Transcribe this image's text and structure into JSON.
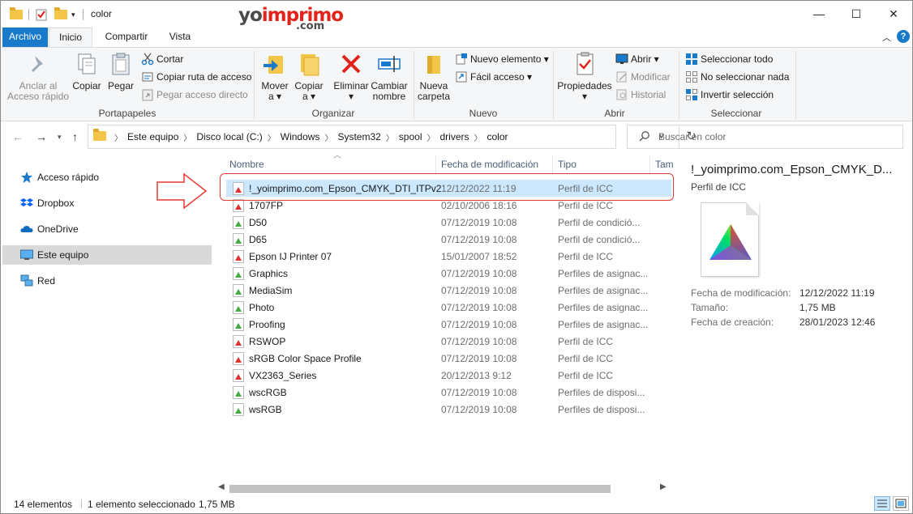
{
  "window": {
    "title": "color",
    "controls": {
      "minimize": "—",
      "maximize": "☐",
      "close": "✕"
    }
  },
  "logo": {
    "part1_a": "yo",
    "part1_b": "imprimo",
    "part2": ".com"
  },
  "ribbon_tabs": {
    "file": "Archivo",
    "home": "Inicio",
    "share": "Compartir",
    "view": "Vista",
    "help": "?"
  },
  "ribbon": {
    "clipboard": {
      "pin_line1": "Anclar al",
      "pin_line2": "Acceso rápido",
      "copy": "Copiar",
      "paste": "Pegar",
      "cut": "Cortar",
      "copy_path": "Copiar ruta de acceso",
      "paste_shortcut": "Pegar acceso directo",
      "label": "Portapapeles"
    },
    "organize": {
      "move_line1": "Mover",
      "move_line2": "a",
      "copyto_line1": "Copiar",
      "copyto_line2": "a",
      "delete": "Eliminar",
      "rename_line1": "Cambiar",
      "rename_line2": "nombre",
      "label": "Organizar"
    },
    "new": {
      "folder_line1": "Nueva",
      "folder_line2": "carpeta",
      "new_item": "Nuevo elemento",
      "easy_access": "Fácil acceso",
      "label": "Nuevo"
    },
    "open": {
      "properties": "Propiedades",
      "open": "Abrir",
      "edit": "Modificar",
      "history": "Historial",
      "label": "Abrir"
    },
    "select": {
      "select_all": "Seleccionar todo",
      "select_none": "No seleccionar nada",
      "invert": "Invertir selección",
      "label": "Seleccionar"
    }
  },
  "address": {
    "crumbs": [
      "Este equipo",
      "Disco local (C:)",
      "Windows",
      "System32",
      "spool",
      "drivers",
      "color"
    ],
    "search_placeholder": "Buscar en color"
  },
  "nav_pane": {
    "items": [
      {
        "label": "Acceso rápido",
        "icon": "star-icon"
      },
      {
        "label": "Dropbox",
        "icon": "dropbox-icon"
      },
      {
        "label": "OneDrive",
        "icon": "cloud-icon"
      },
      {
        "label": "Este equipo",
        "icon": "computer-icon"
      },
      {
        "label": "Red",
        "icon": "network-icon"
      }
    ]
  },
  "file_list": {
    "columns": {
      "name": "Nombre",
      "date": "Fecha de modificación",
      "type": "Tipo",
      "size": "Tam"
    },
    "rows": [
      {
        "name": "!_yoimprimo.com_Epson_CMYK_DTI_ITPv2",
        "date": "12/12/2022 11:19",
        "type": "Perfil de ICC"
      },
      {
        "name": "1707FP",
        "date": "02/10/2006 18:16",
        "type": "Perfil de ICC"
      },
      {
        "name": "D50",
        "date": "07/12/2019 10:08",
        "type": "Perfil de condició..."
      },
      {
        "name": "D65",
        "date": "07/12/2019 10:08",
        "type": "Perfil de condició..."
      },
      {
        "name": "Epson IJ Printer 07",
        "date": "15/01/2007 18:52",
        "type": "Perfil de ICC"
      },
      {
        "name": "Graphics",
        "date": "07/12/2019 10:08",
        "type": "Perfiles de asignac..."
      },
      {
        "name": "MediaSim",
        "date": "07/12/2019 10:08",
        "type": "Perfiles de asignac..."
      },
      {
        "name": "Photo",
        "date": "07/12/2019 10:08",
        "type": "Perfiles de asignac..."
      },
      {
        "name": "Proofing",
        "date": "07/12/2019 10:08",
        "type": "Perfiles de asignac..."
      },
      {
        "name": "RSWOP",
        "date": "07/12/2019 10:08",
        "type": "Perfil de ICC"
      },
      {
        "name": "sRGB Color Space Profile",
        "date": "07/12/2019 10:08",
        "type": "Perfil de ICC"
      },
      {
        "name": "VX2363_Series",
        "date": "20/12/2013 9:12",
        "type": "Perfil de ICC"
      },
      {
        "name": "wscRGB",
        "date": "07/12/2019 10:08",
        "type": "Perfiles de disposi..."
      },
      {
        "name": "wsRGB",
        "date": "07/12/2019 10:08",
        "type": "Perfiles de disposi..."
      }
    ]
  },
  "preview": {
    "title": "!_yoimprimo.com_Epson_CMYK_D...",
    "type": "Perfil de ICC",
    "props": [
      {
        "label": "Fecha de modificación:",
        "value": "12/12/2022 11:19"
      },
      {
        "label": "Tamaño:",
        "value": "1,75 MB"
      },
      {
        "label": "Fecha de creación:",
        "value": "28/01/2023 12:46"
      }
    ]
  },
  "status": {
    "count": "14 elementos",
    "selected": "1 elemento seleccionado",
    "size": "1,75 MB"
  },
  "colors": {
    "accent": "#1979ca",
    "selection": "#cce8ff",
    "highlight": "#e53935"
  }
}
